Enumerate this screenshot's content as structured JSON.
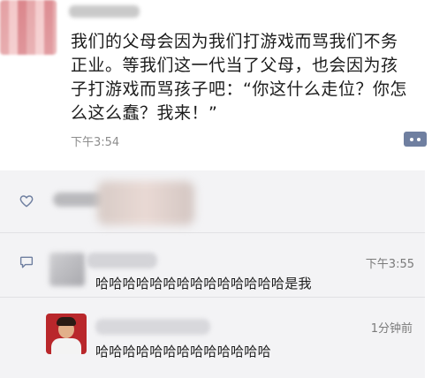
{
  "post": {
    "text": "我们的父母会因为我们打游戏而骂我们不务\n正业。等我们这一代当了父母，也会因为孩\n子打游戏而骂孩子吧：“你这什么走位？你怎\n么这么蠢？我来！”",
    "time": "下午3:54",
    "more_icon": "more-dots-icon"
  },
  "likes": {
    "icon": "heart-icon"
  },
  "comments": [
    {
      "icon": "comment-icon",
      "time": "下午3:55",
      "text": "哈哈哈哈哈哈哈哈哈哈哈哈哈哈是我"
    },
    {
      "time": "1分钟前",
      "text": "哈哈哈哈哈哈哈哈哈哈哈哈哈"
    }
  ],
  "colors": {
    "panel_bg": "#f3f3f5",
    "link_blue": "#6f7fa0",
    "time_gray": "#8d8d8d"
  }
}
